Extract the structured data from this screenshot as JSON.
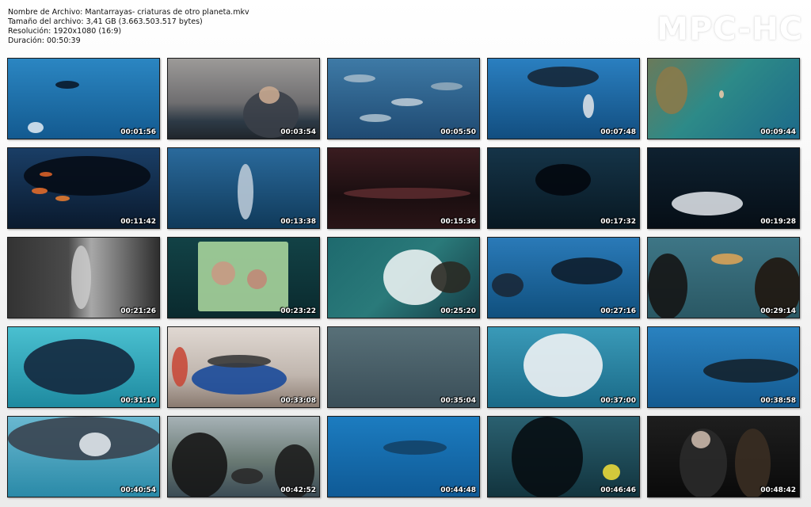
{
  "info": {
    "filename": "Nombre de Archivo: Mantarrayas- criaturas de otro planeta.mkv",
    "filesize": "Tamaño del archivo: 3,41 GB (3.663.503.517 bytes)",
    "resolution": "Resolución: 1920x1080 (16:9)",
    "duration": "Duración: 00:50:39"
  },
  "logo": "MPC-HC",
  "thumbnails": [
    {
      "time": "00:01:56",
      "scene": "diver-fish-blue",
      "bg": "#1d6fa8"
    },
    {
      "time": "00:03:54",
      "scene": "man-binoculars-sunset",
      "bg": "#7a7b80"
    },
    {
      "time": "00:05:50",
      "scene": "fish-school",
      "bg": "#2a5f8a"
    },
    {
      "time": "00:07:48",
      "scene": "manta-diver",
      "bg": "#1b6ea8"
    },
    {
      "time": "00:09:44",
      "scene": "aerial-reef-swimmer",
      "bg": "#2e7e7c"
    },
    {
      "time": "00:11:42",
      "scene": "manta-orange-fish",
      "bg": "#0f2a4a"
    },
    {
      "time": "00:13:38",
      "scene": "dolphin",
      "bg": "#1f5a8c"
    },
    {
      "time": "00:15:36",
      "scene": "dark-sea-surface",
      "bg": "#2a1518"
    },
    {
      "time": "00:17:32",
      "scene": "manta-dark",
      "bg": "#0e2436"
    },
    {
      "time": "00:19:28",
      "scene": "manta-belly-dark",
      "bg": "#0b1a26"
    },
    {
      "time": "00:21:26",
      "scene": "smoke-vent",
      "bg": "#2a2a2a"
    },
    {
      "time": "00:23:22",
      "scene": "brain-chart",
      "bg": "#0f3a3e"
    },
    {
      "time": "00:25:20",
      "scene": "aerial-waves",
      "bg": "#1f5a5a"
    },
    {
      "time": "00:27:16",
      "scene": "manta-divers",
      "bg": "#1a5e90"
    },
    {
      "time": "00:29:14",
      "scene": "aquarium-people",
      "bg": "#3a6a78"
    },
    {
      "time": "00:31:10",
      "scene": "manta-pool",
      "bg": "#2aa3b8"
    },
    {
      "time": "00:33:08",
      "scene": "crew-lifting",
      "bg": "#c8c2bc"
    },
    {
      "time": "00:35:04",
      "scene": "sea-surface",
      "bg": "#455e6a"
    },
    {
      "time": "00:37:00",
      "scene": "manta-white-belly",
      "bg": "#2a8aa8"
    },
    {
      "time": "00:38:58",
      "scene": "manta-shark",
      "bg": "#1a6aa8"
    },
    {
      "time": "00:40:54",
      "scene": "manta-close",
      "bg": "#2a90b0"
    },
    {
      "time": "00:42:52",
      "scene": "divers-boat",
      "bg": "#7d8a90"
    },
    {
      "time": "00:44:48",
      "scene": "manta-deep-blue",
      "bg": "#1670b0"
    },
    {
      "time": "00:46:46",
      "scene": "manta-diver-light",
      "bg": "#234e5c"
    },
    {
      "time": "00:48:42",
      "scene": "men-night",
      "bg": "#151515"
    }
  ]
}
